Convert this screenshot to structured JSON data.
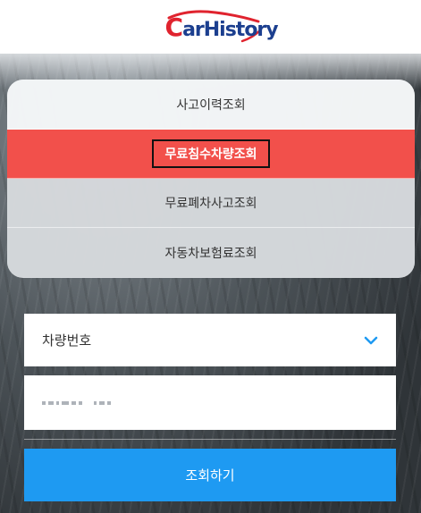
{
  "header": {
    "logo_text_first": "C",
    "logo_text_rest": "arHistory"
  },
  "menu": {
    "items": [
      {
        "label": "사고이력조회"
      },
      {
        "label": "무료침수차량조회"
      },
      {
        "label": "무료폐차사고조회"
      },
      {
        "label": "자동차보험료조회"
      }
    ]
  },
  "form": {
    "select_label": "차량번호",
    "input_value": "",
    "submit_label": "조회하기"
  },
  "colors": {
    "accent_red": "#f2504b",
    "submit_blue": "#1e9af2",
    "logo_red": "#e0232e",
    "logo_blue": "#1c3f8f"
  },
  "icons": [
    "carhistory-logo",
    "car-roof-swoosh-icon",
    "chevron-down-icon"
  ]
}
